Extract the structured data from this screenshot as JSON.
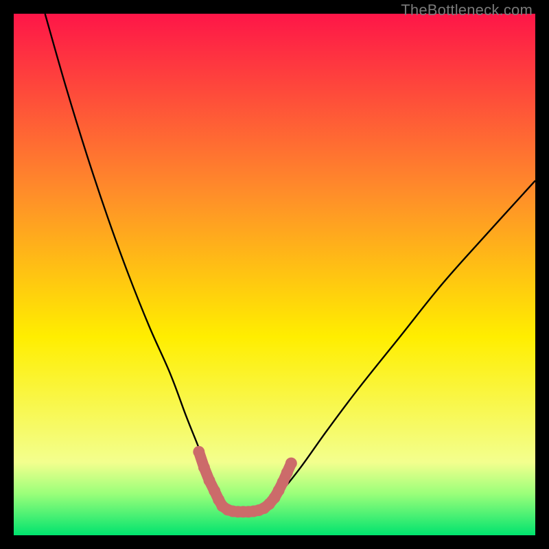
{
  "watermark": "TheBottleneck.com",
  "colors": {
    "bg": "#000000",
    "grad_top": "#fe1648",
    "grad_mid1": "#ff8c2a",
    "grad_mid2": "#ffee00",
    "grad_low": "#f3ff8e",
    "grad_bottom1": "#9bff7a",
    "grad_bottom2": "#00e36e",
    "curve": "#000000",
    "marker": "#cc6b6a"
  },
  "chart_data": {
    "type": "line",
    "title": "",
    "xlabel": "",
    "ylabel": "",
    "xlim": [
      0,
      100
    ],
    "ylim": [
      0,
      100
    ],
    "series": [
      {
        "name": "bottleneck-curve",
        "x": [
          6,
          10,
          14,
          18,
          22,
          26,
          30,
          33,
          35,
          37,
          39,
          40,
          41.5,
          43,
          45,
          47,
          49,
          51,
          55,
          60,
          66,
          74,
          82,
          90,
          100
        ],
        "y": [
          100,
          86,
          73,
          61,
          50,
          40,
          31,
          23,
          18,
          13,
          9,
          6,
          4.5,
          4.5,
          4.5,
          4.8,
          6,
          8,
          13,
          20,
          28,
          38,
          48,
          57,
          68
        ]
      }
    ],
    "highlight": {
      "name": "valley-marker",
      "x": [
        35.5,
        36.5,
        37.5,
        38.5,
        39.3,
        40.0,
        41.0,
        42.0,
        43.0,
        44.0,
        45.0,
        46.0,
        47.0,
        48.0,
        49.0,
        50.0,
        50.8,
        51.6,
        52.4,
        53.2
      ],
      "y": [
        16.0,
        13.0,
        10.5,
        8.5,
        6.8,
        5.6,
        4.9,
        4.6,
        4.5,
        4.5,
        4.5,
        4.6,
        4.8,
        5.2,
        6.0,
        7.2,
        8.6,
        10.2,
        12.0,
        13.8
      ]
    },
    "gradient_stops": [
      {
        "offset": 0.0,
        "key": "grad_top"
      },
      {
        "offset": 0.34,
        "key": "grad_mid1"
      },
      {
        "offset": 0.62,
        "key": "grad_mid2"
      },
      {
        "offset": 0.86,
        "key": "grad_low"
      },
      {
        "offset": 0.92,
        "key": "grad_bottom1"
      },
      {
        "offset": 1.0,
        "key": "grad_bottom2"
      }
    ]
  }
}
